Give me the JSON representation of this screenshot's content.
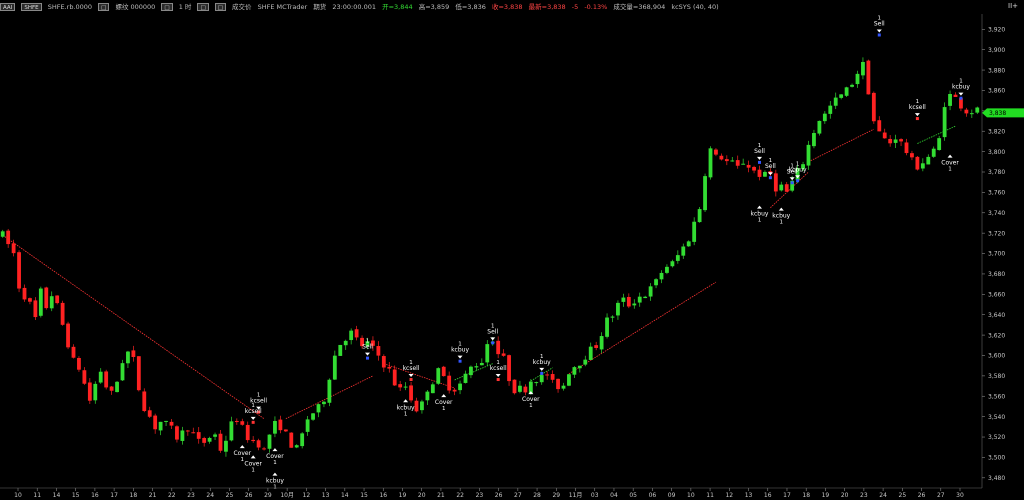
{
  "toolbar": {
    "button_1": "AAI",
    "symbol_button": "SHFE",
    "symbol": "SHFE.rb.0000",
    "btn_a": "□",
    "name": "螺纹 000000",
    "btn_b": "□",
    "interval": "1 时",
    "btn_c": "□",
    "btn_d": "□",
    "price_type": "成交价",
    "feed": "SHFE MCTrader",
    "period": "期货",
    "time": "23:00:00.001",
    "open": "开=3,844",
    "high": "高=3,859",
    "low": "低=3,836",
    "close": "收=3,838",
    "last": "最新=3,838",
    "change": "-5",
    "change_pct": "-0.13%",
    "volume": "成交量=368,904",
    "strategy": "kcSYS (40, 40)",
    "settings_icon": "II+"
  },
  "colors": {
    "background": "#000000",
    "up_candle": "#33dd33",
    "down_candle": "#ff2222",
    "trend_line": "#ff3333",
    "axis_text": "#c8c8c8",
    "price_marker": "#22dd22"
  },
  "chart_data": {
    "type": "candlestick",
    "ylim": [
      3470,
      3935
    ],
    "y_ticks": [
      "3,920",
      "3,900",
      "3,880",
      "3,860",
      "3,840",
      "3,820",
      "3,800",
      "3,780",
      "3,760",
      "3,740",
      "3,720",
      "3,700",
      "3,680",
      "3,660",
      "3,640",
      "3,620",
      "3,600",
      "3,580",
      "3,560",
      "3,540",
      "3,520",
      "3,500",
      "3,480"
    ],
    "x_ticks": [
      "10",
      "11",
      "14",
      "15",
      "16",
      "17",
      "18",
      "21",
      "22",
      "23",
      "24",
      "25",
      "26",
      "29",
      "10月",
      "12",
      "13",
      "14",
      "15",
      "16",
      "19",
      "20",
      "21",
      "22",
      "23",
      "26",
      "27",
      "28",
      "29",
      "11月",
      "03",
      "04",
      "05",
      "06",
      "09",
      "10",
      "11",
      "12",
      "13",
      "16",
      "17",
      "18",
      "19",
      "20",
      "23",
      "24",
      "25",
      "26",
      "27",
      "30"
    ],
    "last_price_label": "3,838",
    "price_path": [
      [
        0,
        3718
      ],
      [
        2,
        3700
      ],
      [
        3,
        3668
      ],
      [
        5,
        3650
      ],
      [
        6,
        3636
      ],
      [
        7,
        3662
      ],
      [
        8,
        3648
      ],
      [
        9,
        3660
      ],
      [
        10,
        3648
      ],
      [
        11,
        3630
      ],
      [
        12,
        3612
      ],
      [
        13,
        3594
      ],
      [
        14,
        3588
      ],
      [
        15,
        3572
      ],
      [
        16,
        3556
      ],
      [
        17,
        3572
      ],
      [
        18,
        3585
      ],
      [
        19,
        3570
      ],
      [
        20,
        3562
      ],
      [
        21,
        3575
      ],
      [
        22,
        3595
      ],
      [
        23,
        3603
      ],
      [
        24,
        3595
      ],
      [
        25,
        3568
      ],
      [
        26,
        3550
      ],
      [
        27,
        3540
      ],
      [
        28,
        3530
      ],
      [
        29,
        3535
      ],
      [
        30,
        3532
      ],
      [
        31,
        3527
      ],
      [
        32,
        3520
      ],
      [
        33,
        3524
      ],
      [
        34,
        3530
      ],
      [
        35,
        3522
      ],
      [
        36,
        3515
      ],
      [
        37,
        3515
      ],
      [
        38,
        3520
      ],
      [
        39,
        3522
      ],
      [
        40,
        3508
      ],
      [
        41,
        3518
      ],
      [
        42,
        3532
      ],
      [
        43,
        3538
      ],
      [
        44,
        3528
      ],
      [
        45,
        3520
      ],
      [
        46,
        3516
      ],
      [
        47,
        3514
      ],
      [
        48,
        3506
      ],
      [
        49,
        3523
      ],
      [
        50,
        3532
      ],
      [
        51,
        3531
      ],
      [
        52,
        3522
      ],
      [
        53,
        3513
      ],
      [
        54,
        3508
      ],
      [
        55,
        3522
      ],
      [
        56,
        3538
      ],
      [
        57,
        3544
      ],
      [
        58,
        3548
      ],
      [
        59,
        3558
      ],
      [
        60,
        3580
      ],
      [
        61,
        3600
      ],
      [
        62,
        3612
      ],
      [
        63,
        3618
      ],
      [
        64,
        3622
      ],
      [
        65,
        3615
      ],
      [
        66,
        3610
      ],
      [
        67,
        3612
      ],
      [
        68,
        3606
      ],
      [
        69,
        3600
      ],
      [
        70,
        3592
      ],
      [
        71,
        3585
      ],
      [
        72,
        3573
      ],
      [
        73,
        3566
      ],
      [
        74,
        3570
      ],
      [
        75,
        3558
      ],
      [
        76,
        3548
      ],
      [
        77,
        3552
      ],
      [
        78,
        3568
      ],
      [
        79,
        3575
      ],
      [
        80,
        3584
      ],
      [
        81,
        3578
      ],
      [
        82,
        3570
      ],
      [
        83,
        3568
      ],
      [
        84,
        3572
      ],
      [
        85,
        3580
      ],
      [
        86,
        3588
      ],
      [
        87,
        3592
      ],
      [
        88,
        3595
      ],
      [
        89,
        3612
      ],
      [
        90,
        3617
      ],
      [
        91,
        3602
      ],
      [
        92,
        3596
      ],
      [
        93,
        3578
      ],
      [
        94,
        3567
      ],
      [
        95,
        3567
      ],
      [
        96,
        3568
      ],
      [
        97,
        3576
      ],
      [
        98,
        3578
      ],
      [
        99,
        3578
      ],
      [
        100,
        3582
      ],
      [
        101,
        3572
      ],
      [
        102,
        3570
      ],
      [
        103,
        3571
      ],
      [
        104,
        3585
      ],
      [
        105,
        3590
      ],
      [
        106,
        3594
      ],
      [
        107,
        3600
      ],
      [
        108,
        3605
      ],
      [
        109,
        3610
      ],
      [
        110,
        3622
      ],
      [
        111,
        3634
      ],
      [
        112,
        3640
      ],
      [
        113,
        3650
      ],
      [
        114,
        3654
      ],
      [
        115,
        3650
      ],
      [
        116,
        3654
      ],
      [
        117,
        3658
      ],
      [
        118,
        3660
      ],
      [
        119,
        3665
      ],
      [
        120,
        3672
      ],
      [
        121,
        3682
      ],
      [
        122,
        3688
      ],
      [
        123,
        3690
      ],
      [
        124,
        3698
      ],
      [
        125,
        3706
      ],
      [
        126,
        3715
      ],
      [
        127,
        3730
      ],
      [
        128,
        3745
      ],
      [
        129,
        3780
      ],
      [
        130,
        3802
      ],
      [
        131,
        3794
      ],
      [
        132,
        3795
      ],
      [
        133,
        3790
      ],
      [
        134,
        3788
      ],
      [
        135,
        3784
      ],
      [
        136,
        3790
      ],
      [
        137,
        3786
      ],
      [
        138,
        3781
      ],
      [
        139,
        3778
      ],
      [
        140,
        3776
      ],
      [
        141,
        3778
      ],
      [
        142,
        3765
      ],
      [
        143,
        3766
      ],
      [
        144,
        3760
      ],
      [
        145,
        3770
      ],
      [
        146,
        3780
      ],
      [
        147,
        3790
      ],
      [
        148,
        3806
      ],
      [
        149,
        3820
      ],
      [
        150,
        3832
      ],
      [
        151,
        3836
      ],
      [
        152,
        3844
      ],
      [
        153,
        3850
      ],
      [
        154,
        3855
      ],
      [
        155,
        3860
      ],
      [
        156,
        3868
      ],
      [
        157,
        3878
      ],
      [
        158,
        3885
      ],
      [
        159,
        3860
      ],
      [
        160,
        3830
      ],
      [
        161,
        3818
      ],
      [
        162,
        3812
      ],
      [
        163,
        3809
      ],
      [
        164,
        3815
      ],
      [
        165,
        3808
      ],
      [
        166,
        3800
      ],
      [
        167,
        3790
      ],
      [
        168,
        3786
      ],
      [
        169,
        3790
      ],
      [
        170,
        3795
      ],
      [
        171,
        3800
      ],
      [
        172,
        3812
      ],
      [
        173,
        3848
      ],
      [
        174,
        3855
      ],
      [
        175,
        3852
      ],
      [
        176,
        3846
      ],
      [
        177,
        3840
      ]
    ],
    "trend_lines": [
      {
        "from": [
          0,
          3718
        ],
        "to": [
          48,
          3538
        ]
      },
      {
        "from": [
          52,
          3538
        ],
        "to": [
          68,
          3580
        ]
      },
      {
        "from": [
          70,
          3592
        ],
        "to": [
          83,
          3568
        ]
      },
      {
        "from": [
          104,
          3582
        ],
        "to": [
          131,
          3672
        ]
      },
      {
        "from": [
          141,
          3745
        ],
        "to": [
          148,
          3780
        ]
      },
      {
        "from": [
          148,
          3790
        ],
        "to": [
          160,
          3822
        ]
      }
    ],
    "trend_lines_green": [
      {
        "from": [
          83,
          3576
        ],
        "to": [
          90,
          3592
        ]
      },
      {
        "from": [
          97,
          3575
        ],
        "to": [
          101,
          3588
        ]
      },
      {
        "from": [
          168,
          3808
        ],
        "to": [
          175,
          3825
        ]
      }
    ],
    "signals": [
      {
        "label": "kcsell",
        "qty": "1",
        "x": 47,
        "price": 3540,
        "above": true,
        "dir": "down"
      },
      {
        "label": "kcsell",
        "qty": "1",
        "x": 46,
        "price": 3530,
        "above": true,
        "dir": "down"
      },
      {
        "label": "Cover",
        "qty": "1",
        "x": 44,
        "price": 3515,
        "above": false,
        "dir": "up"
      },
      {
        "label": "Cover",
        "qty": "1",
        "x": 46,
        "price": 3505,
        "above": false,
        "dir": "up"
      },
      {
        "label": "Cover",
        "qty": "1",
        "x": 50,
        "price": 3512,
        "above": false,
        "dir": "up"
      },
      {
        "label": "kcbuy",
        "qty": "1",
        "x": 50,
        "price": 3488,
        "above": false,
        "dir": "up"
      },
      {
        "label": "Sell",
        "qty": "1",
        "x": 67,
        "price": 3593,
        "above": true,
        "dir": "down"
      },
      {
        "label": "kcsell",
        "qty": "1",
        "x": 75,
        "price": 3572,
        "above": true,
        "dir": "down"
      },
      {
        "label": "kcbuy",
        "qty": "1",
        "x": 74,
        "price": 3560,
        "above": false,
        "dir": "up"
      },
      {
        "label": "Cover",
        "qty": "1",
        "x": 81,
        "price": 3565,
        "above": false,
        "dir": "up"
      },
      {
        "label": "kcbuy",
        "qty": "1",
        "x": 84,
        "price": 3590,
        "above": true,
        "dir": "down"
      },
      {
        "label": "kcsell",
        "qty": "1",
        "x": 91,
        "price": 3572,
        "above": true,
        "dir": "down"
      },
      {
        "label": "Sell",
        "qty": "1",
        "x": 90,
        "price": 3608,
        "above": true,
        "dir": "down"
      },
      {
        "label": "Cover",
        "qty": "1",
        "x": 97,
        "price": 3568,
        "above": false,
        "dir": "up"
      },
      {
        "label": "kcbuy",
        "qty": "1",
        "x": 99,
        "price": 3578,
        "above": true,
        "dir": "down"
      },
      {
        "label": "Sell",
        "qty": "1",
        "x": 139,
        "price": 3785,
        "above": true,
        "dir": "down"
      },
      {
        "label": "kcbuy",
        "qty": "1",
        "x": 139,
        "price": 3750,
        "above": false,
        "dir": "up"
      },
      {
        "label": "Sell",
        "qty": "1",
        "x": 141,
        "price": 3770,
        "above": true,
        "dir": "down"
      },
      {
        "label": "Sell",
        "qty": "1",
        "x": 145,
        "price": 3765,
        "above": true,
        "dir": "down"
      },
      {
        "label": "kcbuy",
        "qty": "1",
        "x": 143,
        "price": 3748,
        "above": false,
        "dir": "up"
      },
      {
        "label": "kcbuy",
        "qty": "1",
        "x": 146,
        "price": 3767,
        "above": true,
        "dir": "down"
      },
      {
        "label": "Sell",
        "qty": "1",
        "x": 161,
        "price": 3910,
        "above": true,
        "dir": "down"
      },
      {
        "label": "kcsell",
        "qty": "1",
        "x": 168,
        "price": 3828,
        "above": true,
        "dir": "down"
      },
      {
        "label": "Cover",
        "qty": "1",
        "x": 174,
        "price": 3800,
        "above": false,
        "dir": "up"
      },
      {
        "label": "kcbuy",
        "qty": "1",
        "x": 176,
        "price": 3848,
        "above": true,
        "dir": "down"
      }
    ]
  }
}
